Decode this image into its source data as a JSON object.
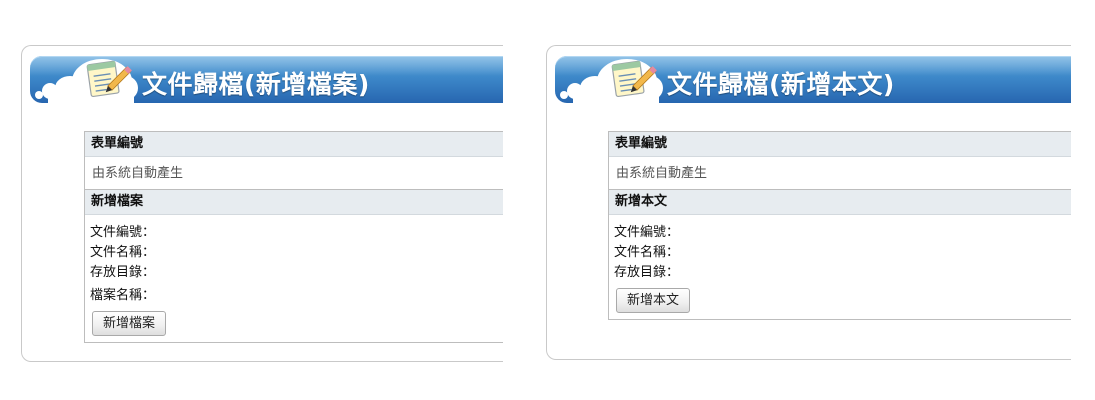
{
  "left_panel": {
    "title": "文件歸檔(新增檔案)",
    "form_number_header": "表單編號",
    "form_number_value": "由系統自動產生",
    "section_header": "新增檔案",
    "fields": [
      "文件編號：",
      "文件名稱：",
      "存放目錄：",
      "檔案名稱："
    ],
    "button_label": "新增檔案"
  },
  "right_panel": {
    "title": "文件歸檔(新增本文)",
    "form_number_header": "表單編號",
    "form_number_value": "由系統自動產生",
    "section_header": "新增本文",
    "fields": [
      "文件編號：",
      "文件名稱：",
      "存放目錄："
    ],
    "button_label": "新增本文"
  },
  "colors": {
    "title_bar": "#3d88c9",
    "section_header_bg": "#e7ecf0"
  },
  "icons": {
    "title_icon": "notepad-pencil-icon"
  }
}
